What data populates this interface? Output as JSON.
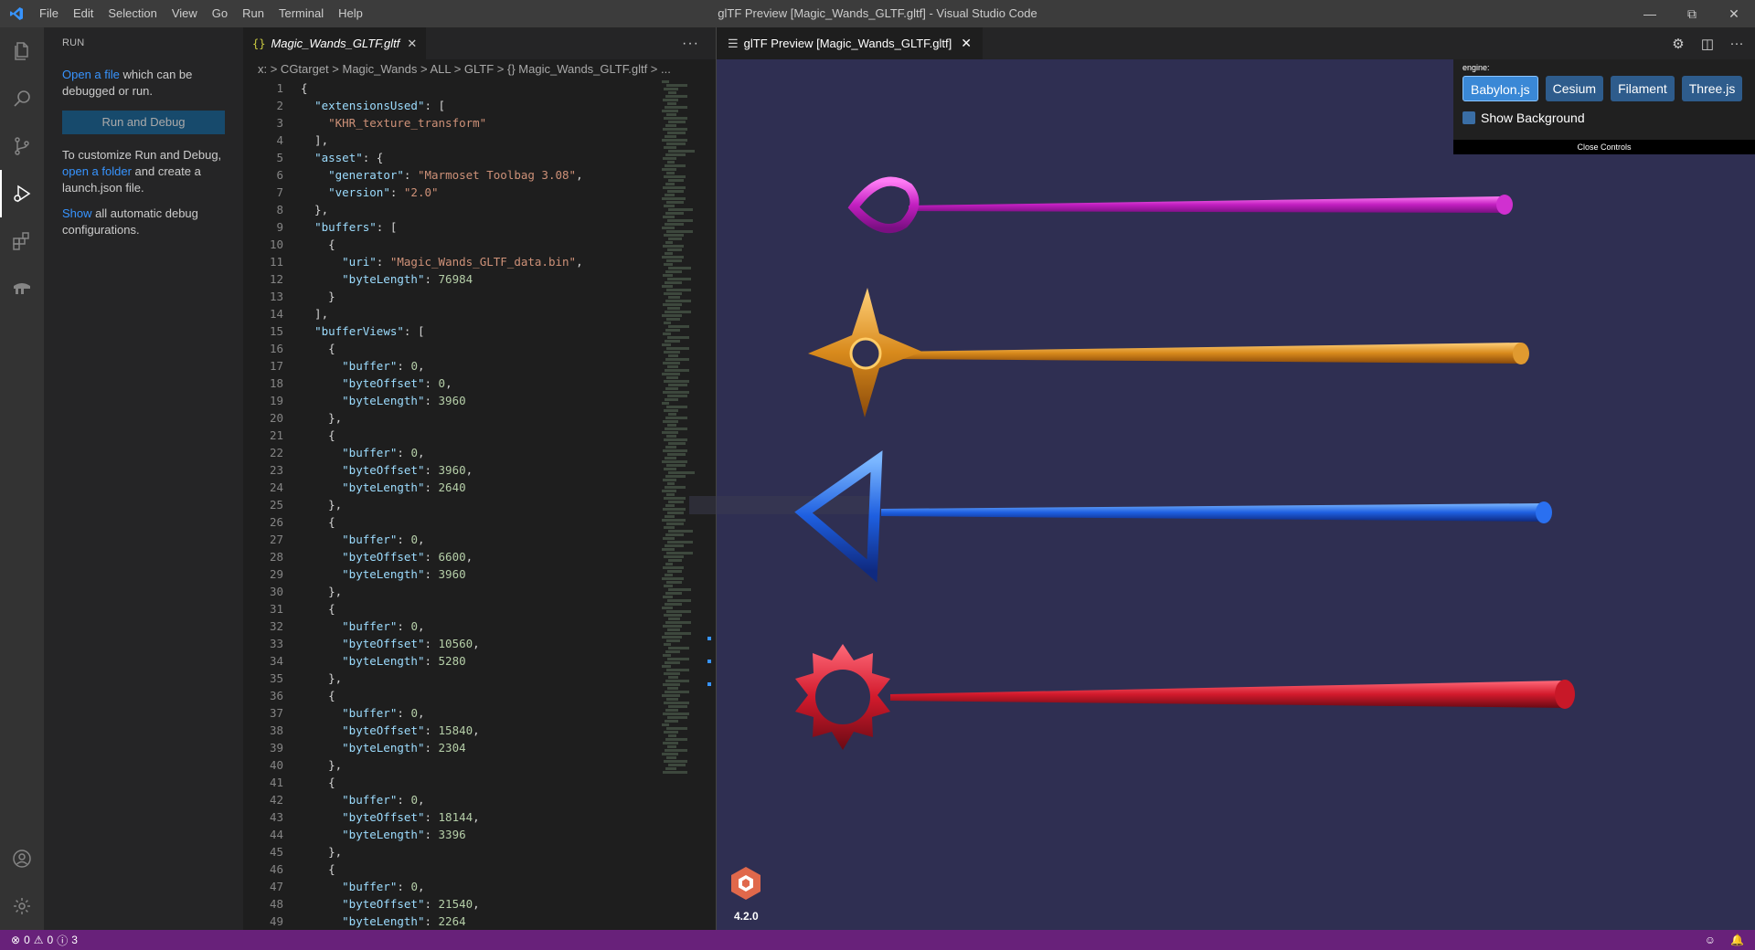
{
  "titlebar": {
    "title": "glTF Preview [Magic_Wands_GLTF.gltf] - Visual Studio Code",
    "menu": [
      "File",
      "Edit",
      "Selection",
      "View",
      "Go",
      "Run",
      "Terminal",
      "Help"
    ]
  },
  "sidebar": {
    "header": "RUN",
    "open_file_link": "Open a file",
    "open_file_rest": " which can be debugged or run.",
    "run_button": "Run and Debug",
    "customize_text_1": "To customize Run and Debug, ",
    "open_folder_link": "open a folder",
    "customize_text_2": " and create a launch.json file.",
    "show_link": "Show",
    "show_rest": " all automatic debug configurations."
  },
  "editor": {
    "tab_label": "Magic_Wands_GLTF.gltf",
    "breadcrumb": "x: > CGtarget > Magic_Wands > ALL > GLTF > {} Magic_Wands_GLTF.gltf > ...",
    "lines": [
      "{",
      "  \"extensionsUsed\": [",
      "    \"KHR_texture_transform\"",
      "  ],",
      "  \"asset\": {",
      "    \"generator\": \"Marmoset Toolbag 3.08\",",
      "    \"version\": \"2.0\"",
      "  },",
      "  \"buffers\": [",
      "    {",
      "      \"uri\": \"Magic_Wands_GLTF_data.bin\",",
      "      \"byteLength\": 76984",
      "    }",
      "  ],",
      "  \"bufferViews\": [",
      "    {",
      "      \"buffer\": 0,",
      "      \"byteOffset\": 0,",
      "      \"byteLength\": 3960",
      "    },",
      "    {",
      "      \"buffer\": 0,",
      "      \"byteOffset\": 3960,",
      "      \"byteLength\": 2640",
      "    },",
      "    {",
      "      \"buffer\": 0,",
      "      \"byteOffset\": 6600,",
      "      \"byteLength\": 3960",
      "    },",
      "    {",
      "      \"buffer\": 0,",
      "      \"byteOffset\": 10560,",
      "      \"byteLength\": 5280",
      "    },",
      "    {",
      "      \"buffer\": 0,",
      "      \"byteOffset\": 15840,",
      "      \"byteLength\": 2304",
      "    },",
      "    {",
      "      \"buffer\": 0,",
      "      \"byteOffset\": 18144,",
      "      \"byteLength\": 3396",
      "    },",
      "    {",
      "      \"buffer\": 0,",
      "      \"byteOffset\": 21540,",
      "      \"byteLength\": 2264"
    ]
  },
  "preview": {
    "tab_label": "glTF Preview [Magic_Wands_GLTF.gltf]",
    "engine_label": "engine:",
    "engines": [
      "Babylon.js",
      "Cesium",
      "Filament",
      "Three.js"
    ],
    "active_engine": "Babylon.js",
    "show_background_label": "Show Background",
    "close_controls_label": "Close Controls",
    "babylon_version": "4.2.0"
  },
  "statusbar": {
    "errors": "0",
    "warnings": "0",
    "infos": "3"
  },
  "colors": {
    "statusbar_bg": "#68217a",
    "canvas_bg": "#2f2f52",
    "accent": "#0e639c"
  }
}
